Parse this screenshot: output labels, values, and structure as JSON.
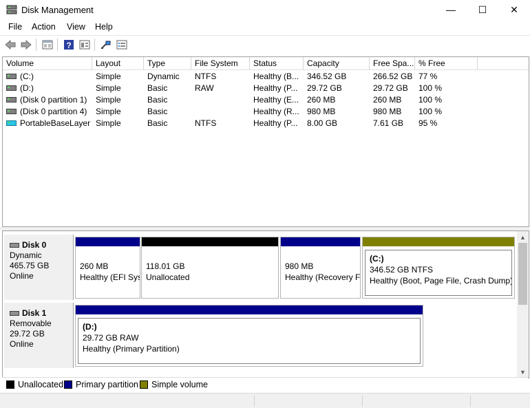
{
  "window": {
    "title": "Disk Management",
    "minimize": "—",
    "maximize": "☐",
    "close": "✕"
  },
  "menu": [
    "File",
    "Action",
    "View",
    "Help"
  ],
  "toolbar": [
    "back-icon",
    "forward-icon",
    "properties-icon",
    "help-icon",
    "console-icon",
    "connect-icon",
    "list-icon"
  ],
  "volume_list": {
    "columns": [
      "Volume",
      "Layout",
      "Type",
      "File System",
      "Status",
      "Capacity",
      "Free Spa...",
      "% Free"
    ],
    "rows": [
      {
        "volume": "(C:)",
        "layout": "Simple",
        "type": "Dynamic",
        "fs": "NTFS",
        "status": "Healthy (B...",
        "capacity": "346.52 GB",
        "free": "266.52 GB",
        "pct": "77 %",
        "icon": "drive-icon"
      },
      {
        "volume": "(D:)",
        "layout": "Simple",
        "type": "Basic",
        "fs": "RAW",
        "status": "Healthy (P...",
        "capacity": "29.72 GB",
        "free": "29.72 GB",
        "pct": "100 %",
        "icon": "drive-icon"
      },
      {
        "volume": "(Disk 0 partition 1)",
        "layout": "Simple",
        "type": "Basic",
        "fs": "",
        "status": "Healthy (E...",
        "capacity": "260 MB",
        "free": "260 MB",
        "pct": "100 %",
        "icon": "drive-icon"
      },
      {
        "volume": "(Disk 0 partition 4)",
        "layout": "Simple",
        "type": "Basic",
        "fs": "",
        "status": "Healthy (R...",
        "capacity": "980 MB",
        "free": "980 MB",
        "pct": "100 %",
        "icon": "drive-icon"
      },
      {
        "volume": "PortableBaseLayer",
        "layout": "Simple",
        "type": "Basic",
        "fs": "NTFS",
        "status": "Healthy (P...",
        "capacity": "8.00 GB",
        "free": "7.61 GB",
        "pct": "95 %",
        "icon": "portable-drive-icon"
      }
    ]
  },
  "disks": [
    {
      "name": "Disk 0",
      "type": "Dynamic",
      "size": "465.75 GB",
      "state": "Online",
      "partitions": [
        {
          "title": "",
          "line1": "260 MB",
          "line2": "Healthy (EFI Sys",
          "color": "#00008b"
        },
        {
          "title": "",
          "line1": "118.01 GB",
          "line2": "Unallocated",
          "color": "#000000"
        },
        {
          "title": "",
          "line1": "980 MB",
          "line2": "Healthy (Recovery F",
          "color": "#00008b"
        },
        {
          "title": "(C:)",
          "line1": "346.52 GB NTFS",
          "line2": "Healthy (Boot, Page File, Crash Dump)",
          "color": "#808000"
        }
      ]
    },
    {
      "name": "Disk 1",
      "type": "Removable",
      "size": "29.72 GB",
      "state": "Online",
      "partitions": [
        {
          "title": "(D:)",
          "line1": "29.72 GB RAW",
          "line2": "Healthy (Primary Partition)",
          "color": "#00008b"
        }
      ]
    }
  ],
  "legend": [
    {
      "label": "Unallocated",
      "color": "#000000"
    },
    {
      "label": "Primary partition",
      "color": "#00008b"
    },
    {
      "label": "Simple volume",
      "color": "#808000"
    }
  ]
}
